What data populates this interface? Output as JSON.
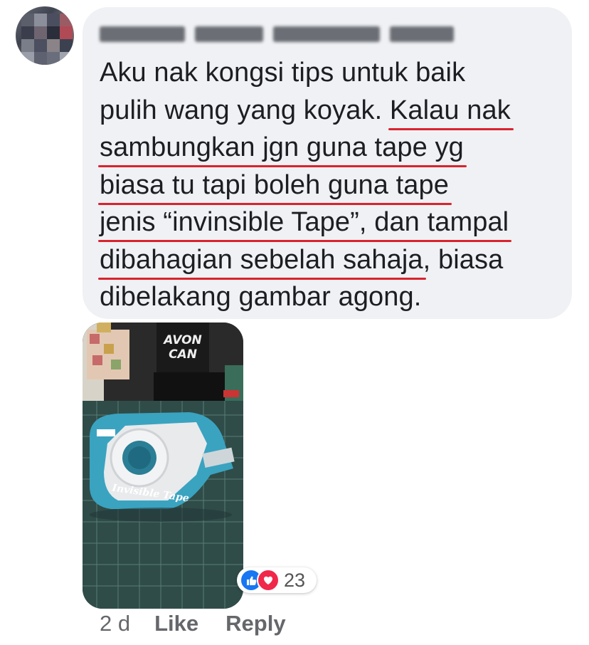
{
  "comment": {
    "author_name": "",
    "text_lines": [
      "Aku nak kongsi tips untuk baik",
      "pulih wang yang koyak. ",
      "Kalau nak",
      "sambungkan jgn guna tape yg",
      "biasa tu tapi boleh guna tape",
      "jenis “invinsible Tape”, dan tampal",
      "dibahagian sebelah sahaja",
      ", biasa",
      "dibelakang gambar agong."
    ],
    "photo": {
      "box_text_top": "AVON",
      "box_text_bottom": "CAN",
      "tape_label": "Invisible Tape"
    },
    "reactions": {
      "types": [
        "like-icon",
        "love-icon"
      ],
      "count": "23"
    },
    "time": "2 d",
    "like_label": "Like",
    "reply_label": "Reply"
  },
  "colors": {
    "bubble": "#eff1f4",
    "underline": "#d9232e",
    "like": "#1877f2",
    "love": "#f0284a",
    "meta_text": "#65676b"
  }
}
